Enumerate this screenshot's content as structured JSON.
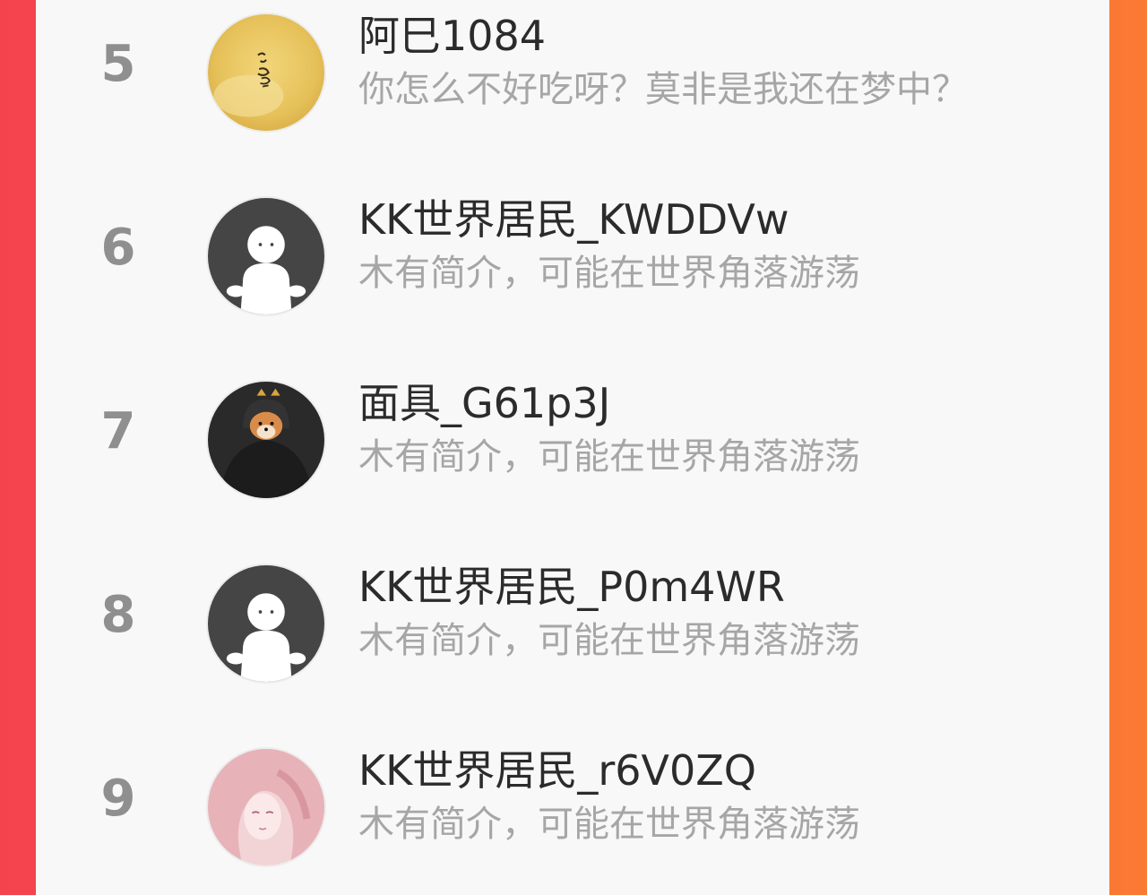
{
  "colors": {
    "background_left": "#f5434e",
    "background_right": "#fb7a33",
    "panel": "#f8f8f8",
    "rank": "#8f8f8f",
    "name": "#2b2b2b",
    "bio": "#a6a6a6"
  },
  "list": {
    "items": [
      {
        "rank": "5",
        "name": "阿巳1084",
        "bio": "你怎么不好吃呀？莫非是我还在梦中？",
        "avatar": "calligraphy-avatar"
      },
      {
        "rank": "6",
        "name": "KK世界居民_KWDDVw",
        "bio": "木有简介，可能在世界角落游荡",
        "avatar": "default-ghost-avatar"
      },
      {
        "rank": "7",
        "name": "面具_G61p3J",
        "bio": "木有简介，可能在世界角落游荡",
        "avatar": "shiba-hood-avatar"
      },
      {
        "rank": "8",
        "name": "KK世界居民_P0m4WR",
        "bio": "木有简介，可能在世界角落游荡",
        "avatar": "default-ghost-avatar"
      },
      {
        "rank": "9",
        "name": "KK世界居民_r6V0ZQ",
        "bio": "木有简介，可能在世界角落游荡",
        "avatar": "anime-girl-avatar"
      }
    ]
  }
}
